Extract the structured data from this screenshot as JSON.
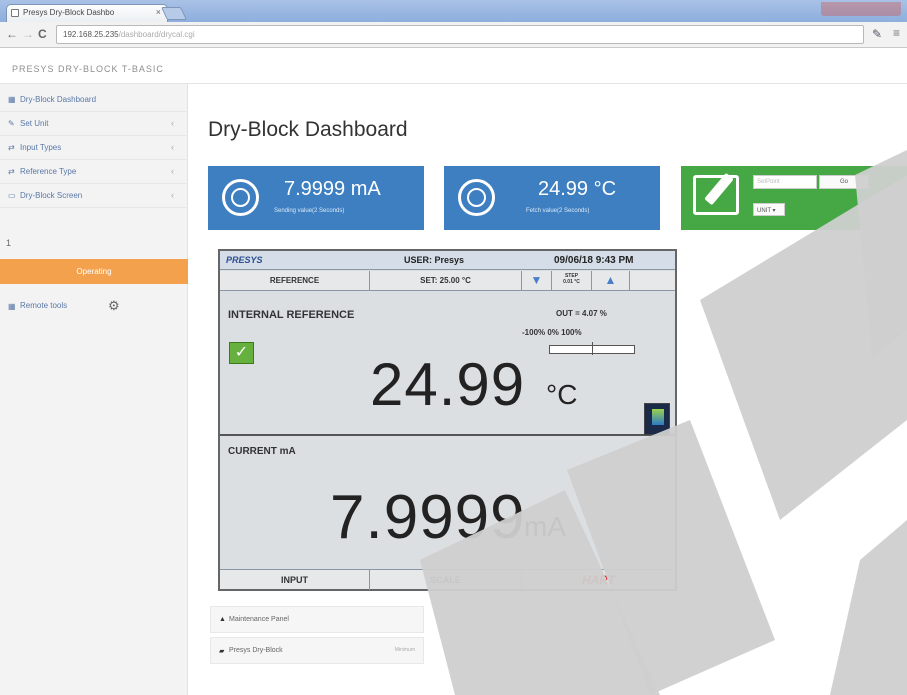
{
  "browser": {
    "tab_title": "Presys Dry-Block Dashbo",
    "tab_close": "×",
    "address": "192.168.25.235",
    "address_path": "/dashboard/drycal.cgi",
    "nav_back": "←",
    "nav_forward": "→",
    "nav_reload": "C"
  },
  "header": {
    "brand": "PRESYS DRY-BLOCK T-BASIC"
  },
  "sidebar": {
    "items": [
      {
        "label": "Dry-Block Dashboard",
        "icon": "dashboard-icon"
      },
      {
        "label": "Set Unit",
        "icon": "wrench-icon"
      },
      {
        "label": "Input Types",
        "icon": "input-icon"
      },
      {
        "label": "Reference Type",
        "icon": "reference-icon"
      },
      {
        "label": "Dry-Block Screen",
        "icon": "screen-icon"
      }
    ],
    "input_value": "1",
    "active_label": "Operating",
    "settings_label": "Remote tools"
  },
  "main": {
    "title": "Dry-Block Dashboard",
    "tiles": [
      {
        "value": "7.9999 mA",
        "caption": "Sending value(2 Seconds)",
        "icon": "gauge-icon"
      },
      {
        "value": "24.99 °C",
        "caption": "Fetch value(2 Seconds)",
        "icon": "gauge-icon"
      }
    ],
    "edit_tile": {
      "input_placeholder": "SetPoint",
      "button_label": "Go",
      "unit_label": "UNIT ▾"
    }
  },
  "device": {
    "brand": "PRESYS",
    "user": "USER: Presys",
    "datetime": "09/06/18  9:43 PM",
    "buttons": {
      "reference": "REFERENCE",
      "set": "SET: 25.00 °C",
      "down": "▼",
      "step": "STEP\n0.01 °C",
      "up": "▲"
    },
    "internal_label": "INTERNAL REFERENCE",
    "checkbox": "✓",
    "temperature": "24.99",
    "temperature_unit": "°C",
    "out_label": "OUT = 4.07 %",
    "out_scale": "-100%  0%  100%",
    "current_label": "CURRENT mA",
    "current": "7.9999",
    "current_unit": "mA",
    "bottom": {
      "input": "INPUT",
      "scale": "SCALE",
      "hart": "HART"
    }
  },
  "bottom_list": [
    {
      "label": "Maintenance Panel",
      "icon": "bell-icon",
      "badge": ""
    },
    {
      "label": "Presys Dry-Block",
      "icon": "comment-icon",
      "badge": "Minimum"
    }
  ],
  "colors": {
    "tile_blue": "#3e7fc1",
    "tile_green": "#45a845",
    "active_orange": "#f4a14d",
    "hart_red": "#e01818"
  }
}
